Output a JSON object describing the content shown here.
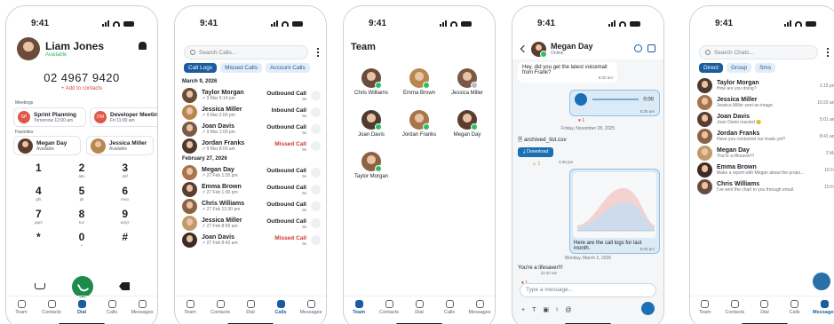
{
  "status_time": "9:41",
  "tabs": [
    "Team",
    "Contacts",
    "Dial",
    "Calls",
    "Messages"
  ],
  "dialer": {
    "user_name": "Liam Jones",
    "user_status": "Available",
    "number": "02 4967 9420",
    "add_to_contacts": "+ Add to contacts",
    "meetings_label": "Meetings",
    "meetings": [
      {
        "initials": "SP",
        "title": "Sprint Planning",
        "time": "Tomorrow 12:00 am",
        "color": "#e0574a"
      },
      {
        "initials": "DM",
        "title": "Developer Meetin",
        "time": "Fri 11:00 am",
        "color": "#e0574a"
      }
    ],
    "favorites_label": "Favorites",
    "favorites": [
      {
        "name": "Megan Day",
        "status": "Available"
      },
      {
        "name": "Jessica Miller",
        "status": "Available"
      }
    ],
    "keys": [
      {
        "d": "1",
        "l": ""
      },
      {
        "d": "2",
        "l": "abc"
      },
      {
        "d": "3",
        "l": "def"
      },
      {
        "d": "4",
        "l": "ghi"
      },
      {
        "d": "5",
        "l": "jkl"
      },
      {
        "d": "6",
        "l": "mno"
      },
      {
        "d": "7",
        "l": "pqrs"
      },
      {
        "d": "8",
        "l": "tuv"
      },
      {
        "d": "9",
        "l": "wxyz"
      },
      {
        "d": "*",
        "l": ""
      },
      {
        "d": "0",
        "l": "+"
      },
      {
        "d": "#",
        "l": ""
      }
    ]
  },
  "calls": {
    "search_placeholder": "Search Calls...",
    "filters": [
      "Call Logs",
      "Missed Calls",
      "Account Calls"
    ],
    "groups": [
      {
        "date": "March 9, 2026",
        "rows": [
          {
            "name": "Taylor Morgan",
            "when": "9 Mar 5:14 pm",
            "type": "Outbound Call",
            "dur": "9s",
            "missed": false
          },
          {
            "name": "Jessica Miller",
            "when": "9 Mar 2:00 pm",
            "type": "Inbound Call",
            "dur": "9s",
            "missed": false
          },
          {
            "name": "Joan Davis",
            "when": "9 Mar 1:00 pm",
            "type": "Outbound Call",
            "dur": "9s",
            "missed": false
          },
          {
            "name": "Jordan Franks",
            "when": "9 Mar 8:00 am",
            "type": "Missed Call",
            "dur": "9s",
            "missed": true
          }
        ]
      },
      {
        "date": "February 27, 2026",
        "rows": [
          {
            "name": "Megan Day",
            "when": "27 Feb 1:55 pm",
            "type": "Outbound Call",
            "dur": "9s",
            "missed": false
          },
          {
            "name": "Emma Brown",
            "when": "27 Feb 1:00 pm",
            "type": "Outbound Call",
            "dur": "9s",
            "missed": false
          },
          {
            "name": "Chris Williams",
            "when": "27 Feb 12:30 pm",
            "type": "Outbound Call",
            "dur": "9s",
            "missed": false
          },
          {
            "name": "Jessica Miller",
            "when": "27 Feb 8:56 am",
            "type": "Outbound Call",
            "dur": "9s",
            "missed": false
          },
          {
            "name": "Joan Davis",
            "when": "27 Feb 8:42 am",
            "type": "Missed Call",
            "dur": "9s",
            "missed": true
          }
        ]
      }
    ]
  },
  "team": {
    "title": "Team",
    "members": [
      "Chris Williams",
      "Emma Brown",
      "Jessica Miller",
      "Joan Davis",
      "Jordan Franks",
      "Megan Day",
      "Taylor Morgan"
    ]
  },
  "chat": {
    "name": "Megan Day",
    "status": "Online",
    "msg1": "Hey, did you get the latest voicemail from Frank?",
    "msg1_time": "6:00 am",
    "voice_duration": "0:00",
    "voice_time": "6:30 am",
    "date1": "Friday, November 28, 2025",
    "file_name": "archived_list.csv",
    "download": "Download",
    "file_time": "3:38 pm",
    "img_caption": "Here are the call logs for last month.",
    "img_time": "5:00 pm",
    "date2": "Monday, March 2, 2026",
    "msg3": "You're a lifesaver!!!",
    "msg3_time": "10:40 am",
    "input_placeholder": "Type a message..."
  },
  "messages": {
    "search_placeholder": "Search Chats...",
    "filters": [
      "Direct",
      "Group",
      "Sms"
    ],
    "rows": [
      {
        "name": "Taylor Morgan",
        "preview": "How are you doing?",
        "time": "1:15 pm"
      },
      {
        "name": "Jessica Miller",
        "preview": "Jessica Miller sent an image.",
        "time": "10:22 am"
      },
      {
        "name": "Joan Davis",
        "preview": "Joan Davis reacted 😊",
        "time": "5:01 am"
      },
      {
        "name": "Jordan Franks",
        "preview": "Have you contacted our leads yet?",
        "time": "8:41 am"
      },
      {
        "name": "Megan Day",
        "preview": "You're a lifesaver!!!",
        "time": "2 Ma"
      },
      {
        "name": "Emma Brown",
        "preview": "Make a report with Megan about the propo...",
        "time": "16 Fe"
      },
      {
        "name": "Chris Williams",
        "preview": "I've sent the chart to you through email.",
        "time": "15 Fe"
      }
    ]
  }
}
